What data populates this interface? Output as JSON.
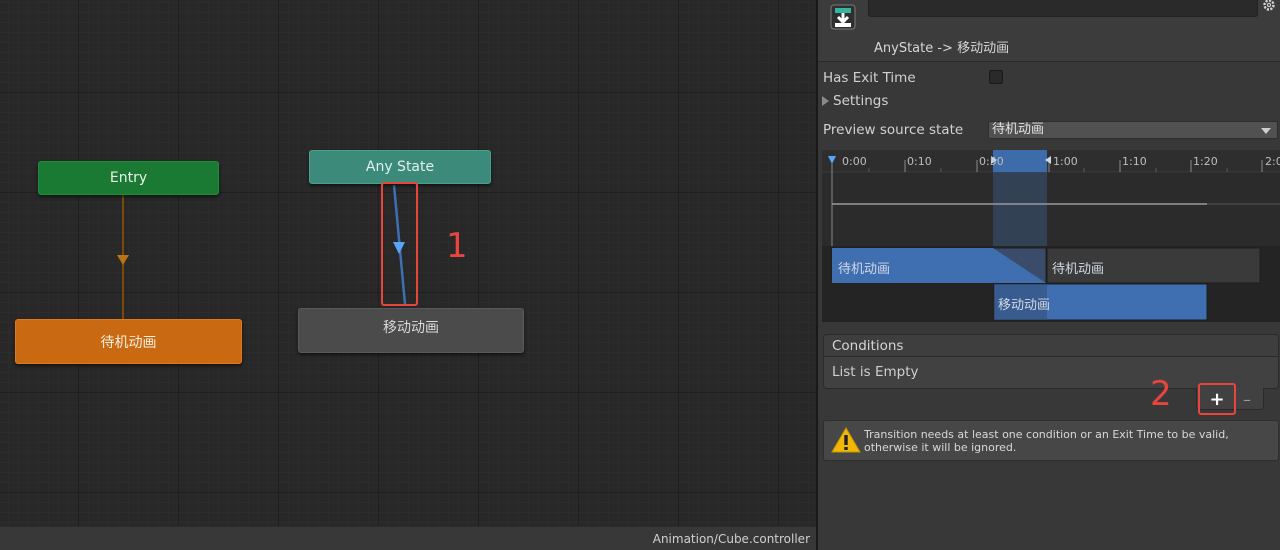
{
  "graph": {
    "nodes": {
      "entry": "Entry",
      "idle": "待机动画",
      "any_state": "Any State",
      "move": "移动动画"
    },
    "status_path": "Animation/Cube.controller"
  },
  "annotations": {
    "one": "1",
    "two": "2"
  },
  "inspector": {
    "title": "AnyState -> 移动动画",
    "has_exit_time": {
      "label": "Has Exit Time",
      "checked": false
    },
    "settings_label": "Settings",
    "preview_source": {
      "label": "Preview source state",
      "value": "待机动画"
    },
    "timeline": {
      "ticks": [
        "0:00",
        "0:10",
        "0:50",
        "1:00",
        "1:10",
        "1:20",
        "2:0"
      ],
      "clips": {
        "source_a": "待机动画",
        "source_b": "待机动画",
        "destination": "移动动画"
      }
    },
    "conditions": {
      "header": "Conditions",
      "empty_text": "List is Empty",
      "add_label": "+",
      "remove_label": "–"
    },
    "warning": {
      "line1": "Transition needs at least one condition or an Exit Time to be valid,",
      "line2": "otherwise it will be ignored."
    }
  },
  "colors": {
    "entry": "#1a7a34",
    "idle": "#c96a12",
    "any_state": "#3b8a7a",
    "move": "#4b4b4b",
    "accent_blue": "#3f6fb0",
    "annotation_red": "#e8453c"
  },
  "icons": [
    "transition-icon",
    "gear-icon",
    "warning-icon",
    "expand-arrow-icon",
    "dropdown-caret-icon"
  ]
}
